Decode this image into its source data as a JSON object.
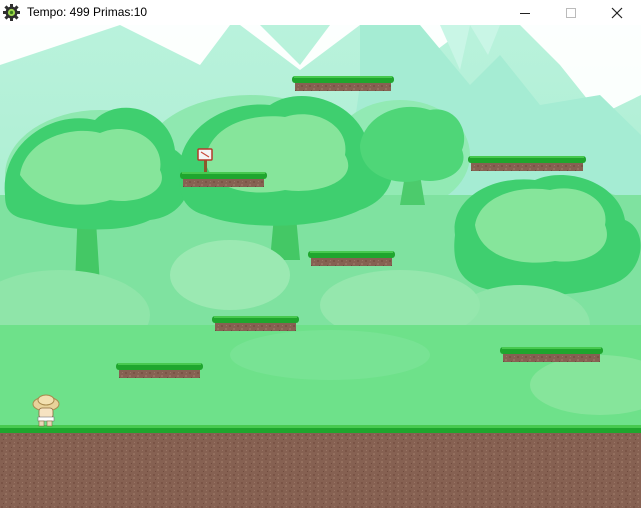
{
  "window": {
    "title": "Tempo: 499 Primas:10",
    "app_icon": "gear-icon",
    "controls": {
      "minimize_icon": "minimize-icon",
      "maximize_icon": "maximize-icon",
      "close_icon": "close-icon"
    }
  },
  "scene": {
    "background": "forest",
    "platform_count": 8,
    "colors": {
      "sky": "#9ae9c3",
      "grass": "#1fa62e",
      "grass_light": "#47c94f",
      "dirt": "#866152",
      "tree_dark": "#3fcf6f",
      "tree_light": "#86e59b"
    }
  }
}
